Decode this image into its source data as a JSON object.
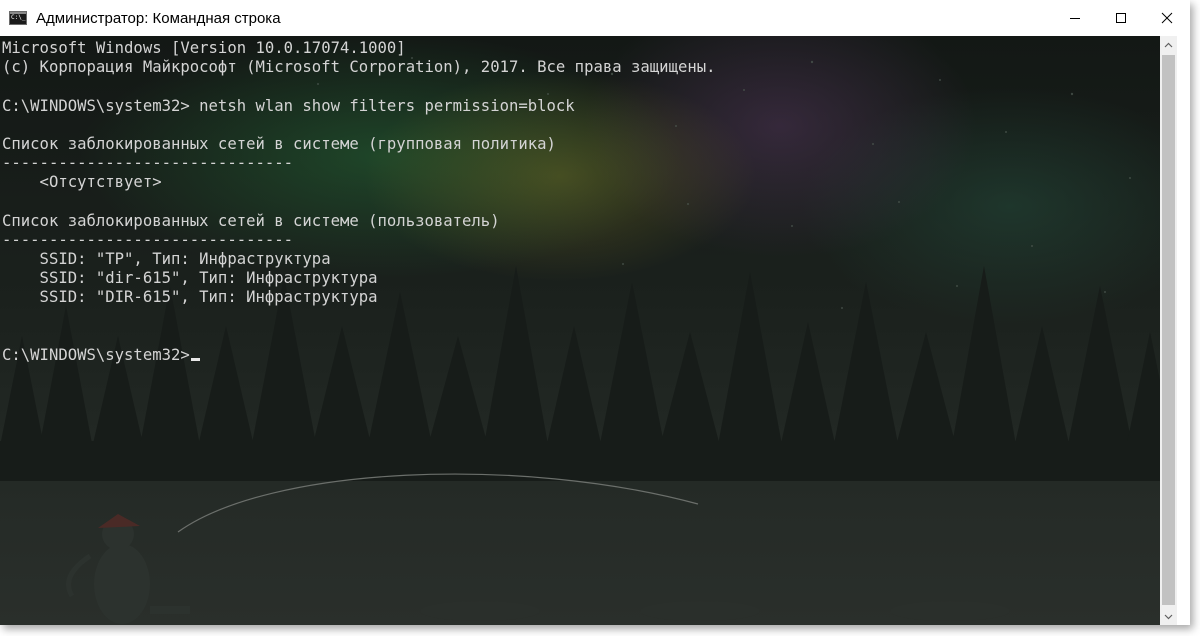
{
  "window": {
    "title": "Администратор: Командная строка",
    "icon": "cmd-icon"
  },
  "controls": {
    "minimize": "minimize-icon",
    "maximize": "maximize-icon",
    "close": "close-icon"
  },
  "console": {
    "lines": [
      "Microsoft Windows [Version 10.0.17074.1000]",
      "(c) Корпорация Майкрософт (Microsoft Corporation), 2017. Все права защищены.",
      "",
      "C:\\WINDOWS\\system32> netsh wlan show filters permission=block",
      "",
      "Список заблокированных сетей в системе (групповая политика)",
      "-------------------------------",
      "    <Отсутствует>",
      "",
      "Список заблокированных сетей в системе (пользователь)",
      "-------------------------------",
      "    SSID: \"TP\", Тип: Инфраструктура",
      "    SSID: \"dir-615\", Тип: Инфраструктура",
      "    SSID: \"DIR-615\", Тип: Инфраструктура",
      "",
      "",
      "C:\\WINDOWS\\system32>"
    ]
  },
  "colors": {
    "console_text": "#d4d4d4",
    "console_background": "#1f2420",
    "titlebar": "#ffffff"
  }
}
